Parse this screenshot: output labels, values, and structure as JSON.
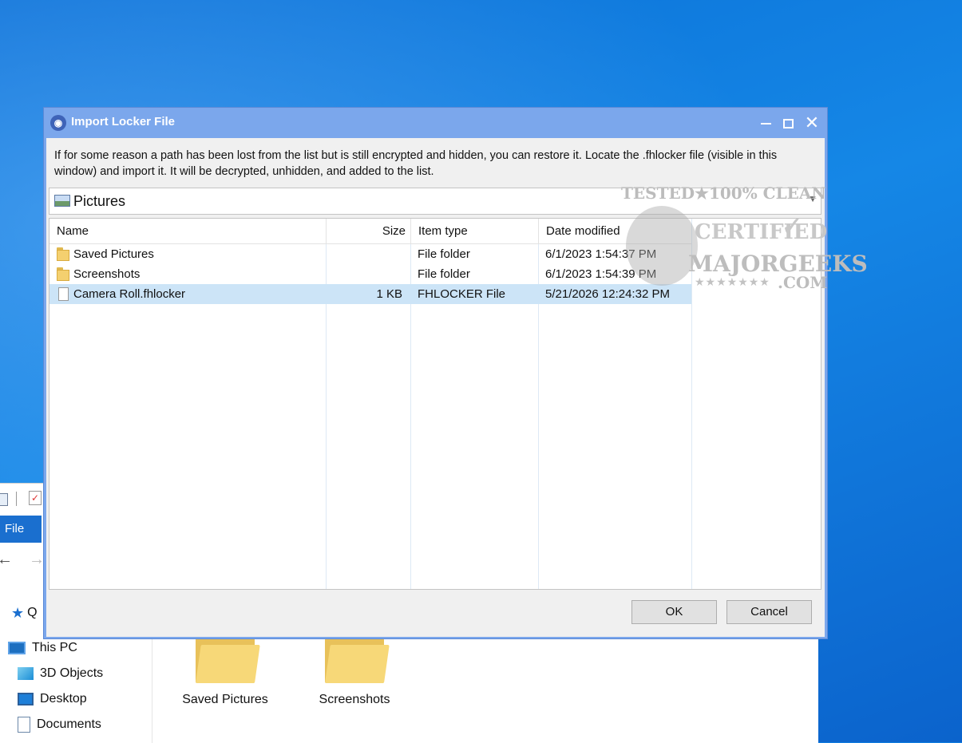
{
  "dialog": {
    "title": "Import Locker File",
    "title_icon": "eye-lock-icon",
    "description": "If for some reason a path has been lost from the list but is still encrypted and hidden, you can restore it. Locate the .fhlocker file (visible in this window) and import it. It will be decrypted, unhidden, and added to the list.",
    "location": "Pictures",
    "columns": [
      "Name",
      "Size",
      "Item type",
      "Date modified"
    ],
    "files": [
      {
        "name": "Saved Pictures",
        "size": "",
        "type": "File folder",
        "date": "6/1/2023 1:54:37 PM",
        "icon": "folder-icon",
        "selected": false
      },
      {
        "name": "Screenshots",
        "size": "",
        "type": "File folder",
        "date": "6/1/2023 1:54:39 PM",
        "icon": "folder-icon",
        "selected": false
      },
      {
        "name": "Camera Roll.fhlocker",
        "size": "1 KB",
        "type": "FHLOCKER File",
        "date": "5/21/2026 12:24:32 PM",
        "icon": "file-icon",
        "selected": true
      }
    ],
    "ok_label": "OK",
    "cancel_label": "Cancel",
    "titlebar_color": "#7ba7ec",
    "selection_color": "#cce4f7"
  },
  "explorer": {
    "file_tab": "File",
    "quick_access": "Q",
    "tree": [
      "This PC",
      "3D Objects",
      "Desktop",
      "Documents"
    ],
    "folders": [
      "Saved Pictures",
      "Screenshots"
    ]
  },
  "watermark": {
    "top": "TESTED★100% CLEAN",
    "certified": "CERTIFIED",
    "brand": "MAJORGEEKS",
    "stars": "★★★★★★★",
    "domain": ".COM"
  },
  "desktop_color": "#0a6fd6"
}
